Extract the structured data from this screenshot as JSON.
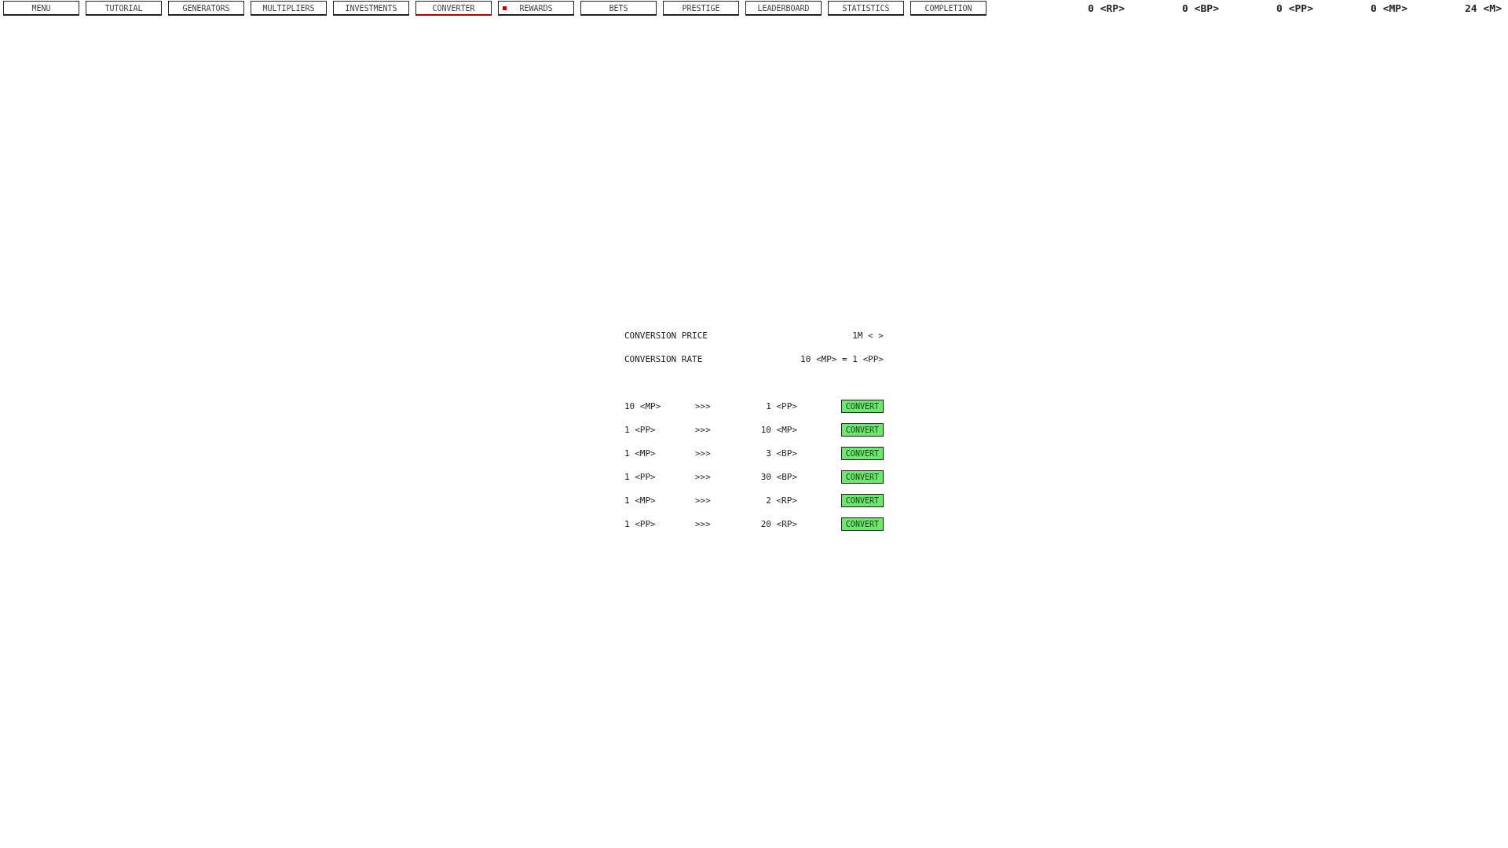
{
  "tabs": [
    {
      "label": "MENU",
      "selected": false,
      "notify": false
    },
    {
      "label": "TUTORIAL",
      "selected": false,
      "notify": false
    },
    {
      "label": "GENERATORS",
      "selected": false,
      "notify": false
    },
    {
      "label": "MULTIPLIERS",
      "selected": false,
      "notify": false
    },
    {
      "label": "INVESTMENTS",
      "selected": false,
      "notify": false
    },
    {
      "label": "CONVERTER",
      "selected": true,
      "notify": false
    },
    {
      "label": "REWARDS",
      "selected": false,
      "notify": true
    },
    {
      "label": "BETS",
      "selected": false,
      "notify": false
    },
    {
      "label": "PRESTIGE",
      "selected": false,
      "notify": false
    },
    {
      "label": "LEADERBOARD",
      "selected": false,
      "notify": false
    },
    {
      "label": "STATISTICS",
      "selected": false,
      "notify": false
    },
    {
      "label": "COMPLETION",
      "selected": false,
      "notify": false
    }
  ],
  "currencies": [
    "0 <RP>",
    "0 <BP>",
    "0 <PP>",
    "0 <MP>",
    "24 <M>"
  ],
  "info": [
    {
      "label": "CONVERSION PRICE",
      "value": "1M < >"
    },
    {
      "label": "CONVERSION RATE",
      "value": "10 <MP> = 1 <PP>"
    }
  ],
  "conversions": [
    {
      "from": "10 <MP>",
      "arrow": ">>>",
      "to": "1 <PP>",
      "button": "CONVERT"
    },
    {
      "from": "1 <PP>",
      "arrow": ">>>",
      "to": "10 <MP>",
      "button": "CONVERT"
    },
    {
      "from": "1 <MP>",
      "arrow": ">>>",
      "to": "3 <BP>",
      "button": "CONVERT"
    },
    {
      "from": "1 <PP>",
      "arrow": ">>>",
      "to": "30 <BP>",
      "button": "CONVERT"
    },
    {
      "from": "1 <MP>",
      "arrow": ">>>",
      "to": "2 <RP>",
      "button": "CONVERT"
    },
    {
      "from": "1 <PP>",
      "arrow": ">>>",
      "to": "20 <RP>",
      "button": "CONVERT"
    }
  ]
}
